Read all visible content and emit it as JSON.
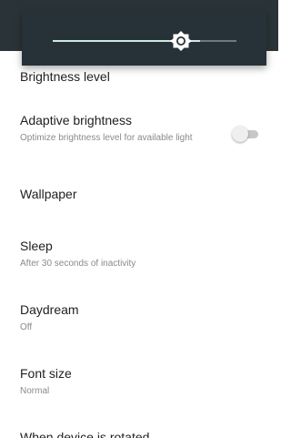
{
  "brightness_slider": {
    "level": 0.76
  },
  "settings": [
    {
      "title": "Brightness level"
    },
    {
      "title": "Adaptive brightness",
      "summary": "Optimize brightness level for available light",
      "toggle_on": false
    },
    {
      "title": "Wallpaper"
    },
    {
      "title": "Sleep",
      "summary": "After 30 seconds of inactivity"
    },
    {
      "title": "Daydream",
      "summary": "Off"
    },
    {
      "title": "Font size",
      "summary": "Normal"
    },
    {
      "title": "When device is rotated"
    }
  ],
  "colors": {
    "app_bar": "#2a3438",
    "popup": "#263238",
    "accent": "#cfe8e3"
  }
}
